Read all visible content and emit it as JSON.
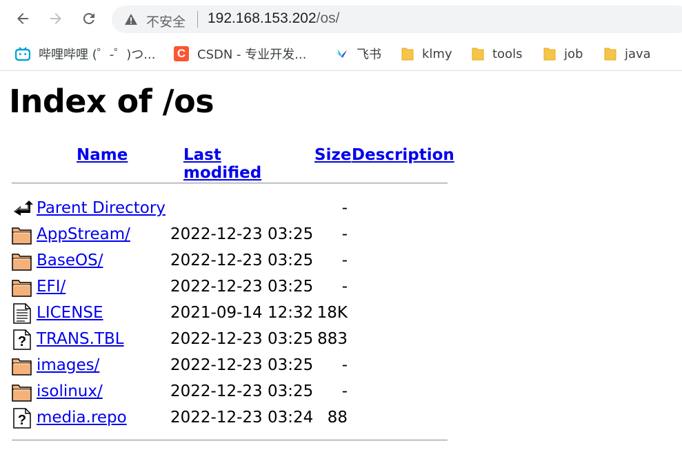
{
  "browser": {
    "security_label": "不安全",
    "url_host": "192.168.153.202",
    "url_path": "/os/"
  },
  "bookmarks": [
    {
      "label": "哔哩哔哩 (゜-゜)つ...",
      "icon": "bilibili-icon"
    },
    {
      "label": "CSDN - 专业开发...",
      "icon": "csdn-icon"
    },
    {
      "label": "飞书",
      "icon": "feishu-icon"
    },
    {
      "label": "klmy",
      "icon": "folder-icon"
    },
    {
      "label": "tools",
      "icon": "folder-icon"
    },
    {
      "label": "job",
      "icon": "folder-icon"
    },
    {
      "label": "java",
      "icon": "folder-icon"
    }
  ],
  "page": {
    "title": "Index of /os",
    "columns": {
      "name": "Name",
      "last_modified": "Last modified",
      "size": "Size",
      "description": "Description"
    },
    "rows": [
      {
        "icon": "back-icon",
        "name": "Parent Directory",
        "date": "",
        "size": "-"
      },
      {
        "icon": "folder-icon",
        "name": "AppStream/",
        "date": "2022-12-23 03:25",
        "size": "-"
      },
      {
        "icon": "folder-icon",
        "name": "BaseOS/",
        "date": "2022-12-23 03:25",
        "size": "-"
      },
      {
        "icon": "folder-icon",
        "name": "EFI/",
        "date": "2022-12-23 03:25",
        "size": "-"
      },
      {
        "icon": "text-file-icon",
        "name": "LICENSE",
        "date": "2021-09-14 12:32",
        "size": "18K"
      },
      {
        "icon": "unknown-file-icon",
        "name": "TRANS.TBL",
        "date": "2022-12-23 03:25",
        "size": "883"
      },
      {
        "icon": "folder-icon",
        "name": "images/",
        "date": "2022-12-23 03:25",
        "size": "-"
      },
      {
        "icon": "folder-icon",
        "name": "isolinux/",
        "date": "2022-12-23 03:25",
        "size": "-"
      },
      {
        "icon": "unknown-file-icon",
        "name": "media.repo",
        "date": "2022-12-23 03:24",
        "size": "88"
      }
    ]
  }
}
